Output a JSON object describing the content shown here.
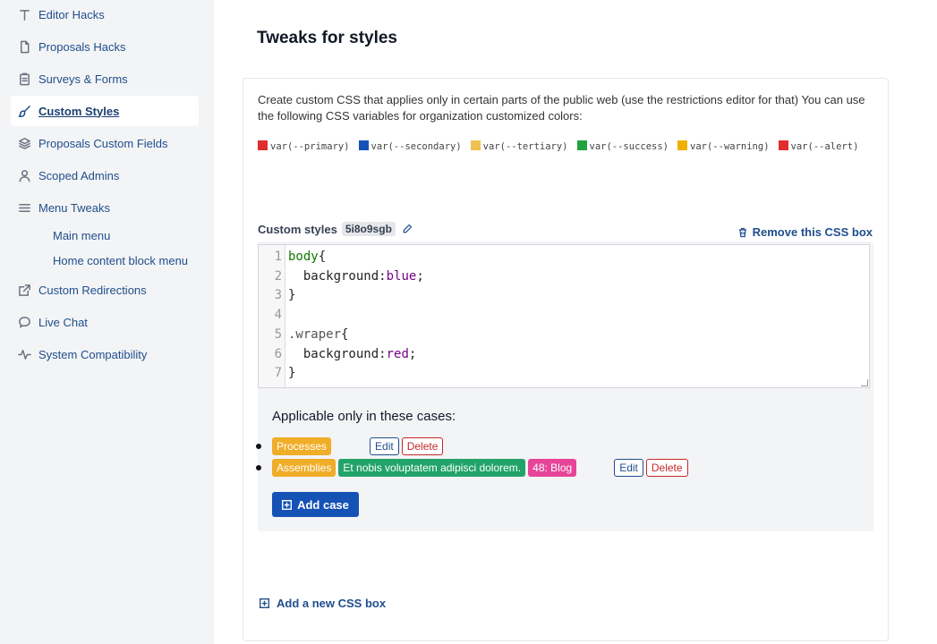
{
  "sidebar": {
    "items": [
      {
        "label": "Editor Hacks",
        "icon": "text-icon"
      },
      {
        "label": "Proposals Hacks",
        "icon": "file-icon"
      },
      {
        "label": "Surveys & Forms",
        "icon": "clipboard-icon"
      },
      {
        "label": "Custom Styles",
        "icon": "brush-icon",
        "active": true
      },
      {
        "label": "Proposals Custom Fields",
        "icon": "layers-icon"
      },
      {
        "label": "Scoped Admins",
        "icon": "user-icon"
      },
      {
        "label": "Menu Tweaks",
        "icon": "menu-icon"
      },
      {
        "label": "Custom Redirections",
        "icon": "external-link-icon"
      },
      {
        "label": "Live Chat",
        "icon": "chat-icon"
      },
      {
        "label": "System Compatibility",
        "icon": "pulse-icon"
      }
    ],
    "subitems": [
      "Main menu",
      "Home content block menu"
    ]
  },
  "main": {
    "title": "Tweaks for styles",
    "description": "Create custom CSS that applies only in certain parts of the public web (use the restrictions editor for that) You can use the following CSS variables for organization customized colors:",
    "variables": [
      {
        "name": "var(--primary)",
        "color": "#e02d2d"
      },
      {
        "name": "var(--secondary)",
        "color": "#1552b6"
      },
      {
        "name": "var(--tertiary)",
        "color": "#f0c050"
      },
      {
        "name": "var(--success)",
        "color": "#22a340"
      },
      {
        "name": "var(--warning)",
        "color": "#f0b000"
      },
      {
        "name": "var(--alert)",
        "color": "#e02d2d"
      }
    ],
    "custom_styles_label": "Custom styles",
    "custom_styles_id": "5i8o9sgb",
    "remove_label": "Remove this CSS box",
    "code_lines": [
      "body{",
      "  background:blue;",
      "}",
      "",
      ".wraper{",
      "  background:red;",
      "}"
    ],
    "cases_title": "Applicable only in these cases:",
    "cases": [
      {
        "tags": [
          {
            "text": "Processes",
            "color": "orange"
          }
        ],
        "edit": "Edit",
        "delete": "Delete"
      },
      {
        "tags": [
          {
            "text": "Assemblies",
            "color": "orange"
          },
          {
            "text": "Et nobis voluptatem adipisci dolorem.",
            "color": "green"
          },
          {
            "text": "48: Blog",
            "color": "pink"
          }
        ],
        "edit": "Edit",
        "delete": "Delete"
      }
    ],
    "add_case_label": "Add case",
    "add_box_label": "Add a new CSS box"
  }
}
